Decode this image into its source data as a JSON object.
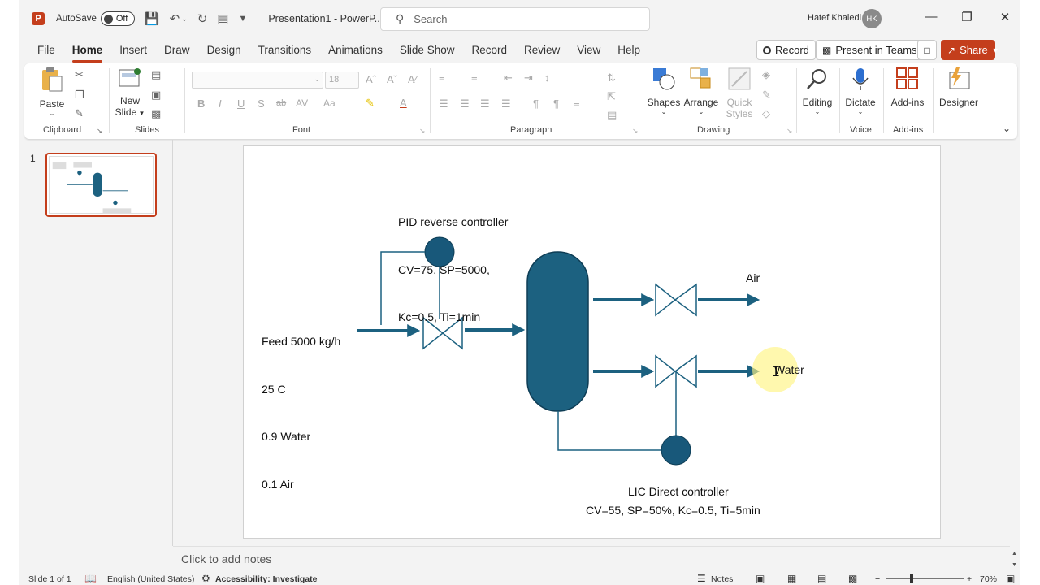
{
  "title_bar": {
    "app_logo_letter": "P",
    "autosave_label": "AutoSave",
    "autosave_state": "Off",
    "document_title": "Presentation1 - PowerP...",
    "search_placeholder": "Search",
    "user_name": "Hatef Khaledi",
    "user_initials": "HK"
  },
  "menu_tabs": [
    "File",
    "Home",
    "Insert",
    "Draw",
    "Design",
    "Transitions",
    "Animations",
    "Slide Show",
    "Record",
    "Review",
    "View",
    "Help"
  ],
  "active_tab": "Home",
  "top_actions": {
    "record": "Record",
    "present_in_teams": "Present in Teams",
    "share": "Share"
  },
  "ribbon": {
    "clipboard": {
      "paste": "Paste",
      "group": "Clipboard"
    },
    "slides": {
      "new_slide_line1": "New",
      "new_slide_line2": "Slide",
      "group": "Slides"
    },
    "font": {
      "size": "18",
      "group": "Font"
    },
    "paragraph": {
      "group": "Paragraph"
    },
    "drawing": {
      "shapes": "Shapes",
      "arrange": "Arrange",
      "quick_styles_line1": "Quick",
      "quick_styles_line2": "Styles",
      "group": "Drawing"
    },
    "editing": {
      "label": "Editing"
    },
    "voice": {
      "dictate": "Dictate",
      "group": "Voice"
    },
    "addins": {
      "label": "Add-ins",
      "group": "Add-ins"
    },
    "designer": {
      "label": "Designer"
    }
  },
  "slides_panel": {
    "slide_number": "1"
  },
  "slide": {
    "pid_title": "PID reverse controller",
    "pid_line2": "CV=75, SP=5000,",
    "pid_line3": "Kc=0.5, Ti=1min",
    "feed_line1": "Feed 5000 kg/h",
    "feed_line2": "25 C",
    "feed_line3": "0.9 Water",
    "feed_line4": "0.1 Air",
    "air_label": "Air",
    "water_label": "Water",
    "lic_title": "LIC Direct controller",
    "lic_line2": "CV=55, SP=50%, Kc=0.5, Ti=5min"
  },
  "colors": {
    "accent": "#c43e1c",
    "process_blue": "#1c6180",
    "controller_blue": "#18587a"
  },
  "notes_placeholder": "Click to add notes",
  "status_bar": {
    "slide_count": "Slide 1 of 1",
    "language": "English (United States)",
    "accessibility": "Accessibility: Investigate",
    "notes": "Notes",
    "zoom": "70%"
  }
}
